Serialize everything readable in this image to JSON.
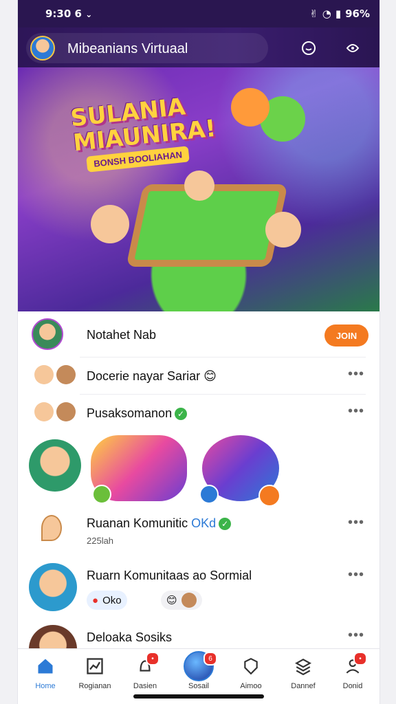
{
  "status_bar": {
    "time": "9:30",
    "left_extra": "6",
    "battery": "96%"
  },
  "app_bar": {
    "title": "Mibeanians Virtuaal"
  },
  "hero": {
    "title": "SULANIA MIAUNIRA!",
    "subtitle": "BONSH BOOLIAHAN"
  },
  "rows": [
    {
      "name": "Notahet Nab",
      "action": "JOIN"
    },
    {
      "name": "Docerie nayar Sariar 😊"
    },
    {
      "name": "Pusaksomanon"
    },
    {
      "name": "Ruanan Komunitic",
      "tag": "OKd",
      "sub": "225lah"
    },
    {
      "name": "Ruarn Komunitaas ao Sormial",
      "chip1": "Oko",
      "chip2": ""
    },
    {
      "name": "Deloaka Sosiks"
    }
  ],
  "bottom_nav": [
    {
      "label": "Home",
      "icon": "home-icon"
    },
    {
      "label": "Rogianan",
      "icon": "chart-icon"
    },
    {
      "label": "Dasien",
      "icon": "bell-icon",
      "badge": ""
    },
    {
      "label": "Sosail",
      "icon": "globe-icon",
      "badge": "6"
    },
    {
      "label": "Aimoo",
      "icon": "shield-icon"
    },
    {
      "label": "Dannef",
      "icon": "layers-icon"
    },
    {
      "label": "Donid",
      "icon": "profile-icon",
      "badge": ""
    }
  ],
  "colors": {
    "accent": "#f47a20",
    "appbar": "#2e1658",
    "nav_active": "#2c7ad6"
  }
}
